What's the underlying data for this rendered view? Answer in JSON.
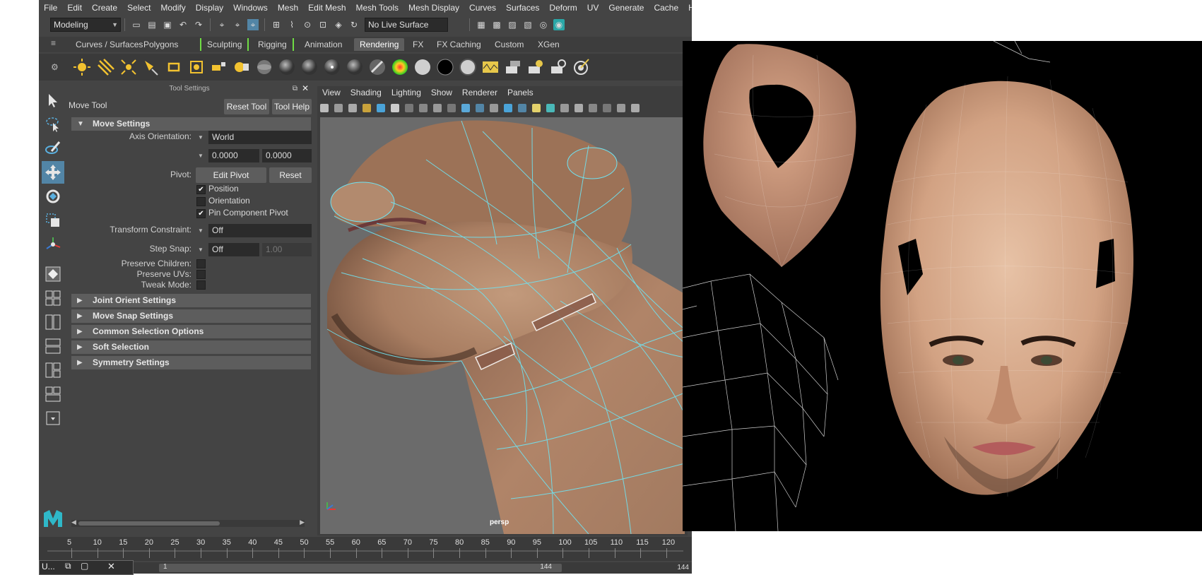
{
  "menubar": {
    "items": [
      "File",
      "Edit",
      "Create",
      "Select",
      "Modify",
      "Display",
      "Windows",
      "Mesh",
      "Edit Mesh",
      "Mesh Tools",
      "Mesh Display",
      "Curves",
      "Surfaces",
      "Deform",
      "UV",
      "Generate",
      "Cache",
      "Help"
    ]
  },
  "statusline": {
    "menuset": "Modeling",
    "live_surface": "No Live Surface"
  },
  "shelf": {
    "tabs": [
      "Curves / Surfaces",
      "Polygons",
      "Sculpting",
      "Rigging",
      "Animation",
      "Rendering",
      "FX",
      "FX Caching",
      "Custom",
      "XGen"
    ],
    "active_tab": "Rendering"
  },
  "tool_settings": {
    "panel_title": "Tool Settings",
    "tool_name": "Move Tool",
    "reset_tool": "Reset Tool",
    "tool_help": "Tool Help",
    "move_settings": "Move Settings",
    "axis_orientation_label": "Axis Orientation:",
    "axis_orientation_value": "World",
    "axis_value_1": "0.0000",
    "axis_value_2": "0.0000",
    "pivot_label": "Pivot:",
    "edit_pivot": "Edit Pivot",
    "reset": "Reset",
    "position": "Position",
    "orientation": "Orientation",
    "pin_component_pivot": "Pin Component Pivot",
    "transform_constraint_label": "Transform Constraint:",
    "transform_constraint_value": "Off",
    "step_snap_label": "Step Snap:",
    "step_snap_value": "Off",
    "step_snap_amount": "1.00",
    "preserve_children": "Preserve Children:",
    "preserve_uvs": "Preserve UVs:",
    "tweak_mode": "Tweak Mode:",
    "sections": [
      "Joint Orient Settings",
      "Move Snap Settings",
      "Common Selection Options",
      "Soft Selection",
      "Symmetry Settings"
    ]
  },
  "viewport": {
    "menus": [
      "View",
      "Shading",
      "Lighting",
      "Show",
      "Renderer",
      "Panels"
    ],
    "camera_label": "persp"
  },
  "timeline": {
    "ticks": [
      "5",
      "10",
      "15",
      "20",
      "25",
      "30",
      "35",
      "40",
      "45",
      "50",
      "55",
      "60",
      "65",
      "70",
      "75",
      "80",
      "85",
      "90",
      "95",
      "100",
      "105",
      "110",
      "115",
      "120"
    ]
  },
  "range": {
    "start": "1",
    "end": "144",
    "end_right": "144"
  },
  "taskbar": {
    "label": "U..."
  },
  "colors": {
    "maya_bg": "#444444",
    "active_blue": "#5285a6",
    "wire_cyan": "#6fe3f2",
    "skin": "#b88a6b"
  }
}
